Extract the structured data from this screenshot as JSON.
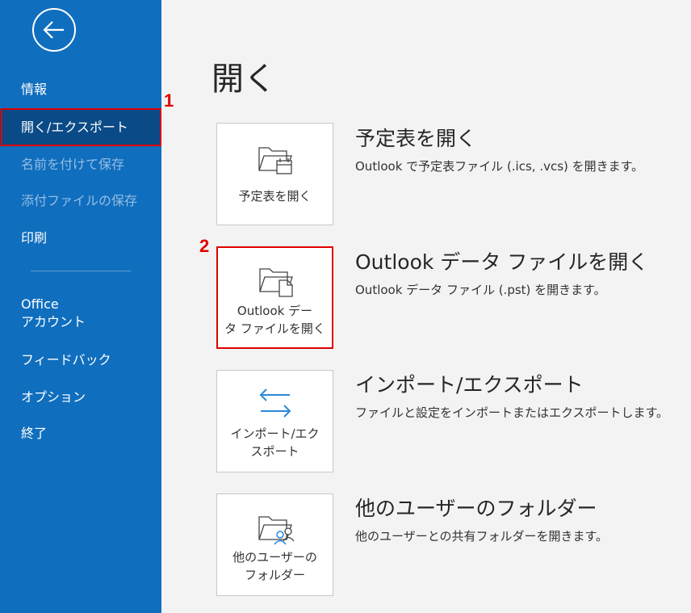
{
  "sidebar": {
    "items": [
      {
        "label": "情報"
      },
      {
        "label": "開く/エクスポート"
      },
      {
        "label": "名前を付けて保存"
      },
      {
        "label": "添付ファイルの保存"
      },
      {
        "label": "印刷"
      },
      {
        "label_line1": "Office",
        "label_line2": "アカウント"
      },
      {
        "label": "フィードバック"
      },
      {
        "label": "オプション"
      },
      {
        "label": "終了"
      }
    ]
  },
  "page": {
    "title": "開く"
  },
  "options": [
    {
      "tile_line1": "予定表を開く",
      "tile_line2": "",
      "title": "予定表を開く",
      "description": "Outlook で予定表ファイル (.ics, .vcs) を開きます。",
      "icon": "folder-calendar-icon"
    },
    {
      "tile_line1": "Outlook デー",
      "tile_line2": "タ ファイルを開く",
      "title": "Outlook データ ファイルを開く",
      "description": "Outlook データ ファイル (.pst) を開きます。",
      "icon": "folder-file-icon"
    },
    {
      "tile_line1": "インポート/エク",
      "tile_line2": "スポート",
      "title": "インポート/エクスポート",
      "description": "ファイルと設定をインポートまたはエクスポートします。",
      "icon": "import-export-arrows-icon"
    },
    {
      "tile_line1": "他のユーザーの",
      "tile_line2": "フォルダー",
      "title": "他のユーザーのフォルダー",
      "description": "他のユーザーとの共有フォルダーを開きます。",
      "icon": "folder-users-icon"
    }
  ],
  "annotations": {
    "step1": "1",
    "step2": "2"
  },
  "colors": {
    "sidebar": "#106ebe",
    "selected": "#0a4a87",
    "highlight": "#e00000",
    "icon_accent": "#2b88d8"
  }
}
